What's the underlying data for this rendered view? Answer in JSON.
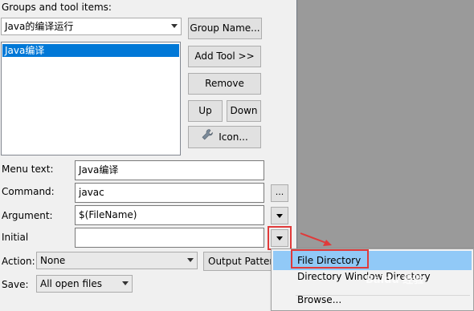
{
  "dialog": {
    "groups_label": "Groups and tool items:",
    "group_select": {
      "value": "Java的编译运行"
    },
    "tool_items": [
      "Java编译"
    ],
    "buttons": {
      "group_name": "Group Name...",
      "add_tool": "Add Tool >>",
      "remove": "Remove",
      "up": "Up",
      "down": "Down",
      "icon": "Icon..."
    },
    "fields": {
      "menu_text_label": "Menu text:",
      "menu_text_value": "Java编译",
      "command_label": "Command:",
      "command_value": "javac",
      "command_browse": "...",
      "argument_label": "Argument:",
      "argument_value": "$(FileName)",
      "initial_label": "Initial",
      "initial_value": ""
    },
    "action": {
      "label": "Action:",
      "value": "None",
      "output_pattern": "Output Patter"
    },
    "save": {
      "label": "Save:",
      "value": "All open files"
    }
  },
  "popup_menu": {
    "items": [
      "File Directory",
      "Directory Window Directory",
      "Browse..."
    ],
    "selected_index": 0
  },
  "watermark": "Baidu 经验",
  "colors": {
    "dialog_bg": "#f0f0f0",
    "selection": "#0078d7",
    "menu_highlight": "#91c9f7",
    "annotation": "#e03a3a",
    "background": "#9a9a9a"
  },
  "icons": {
    "icon_button": "wrench-icon",
    "dropdown": "chevron-down-icon"
  }
}
